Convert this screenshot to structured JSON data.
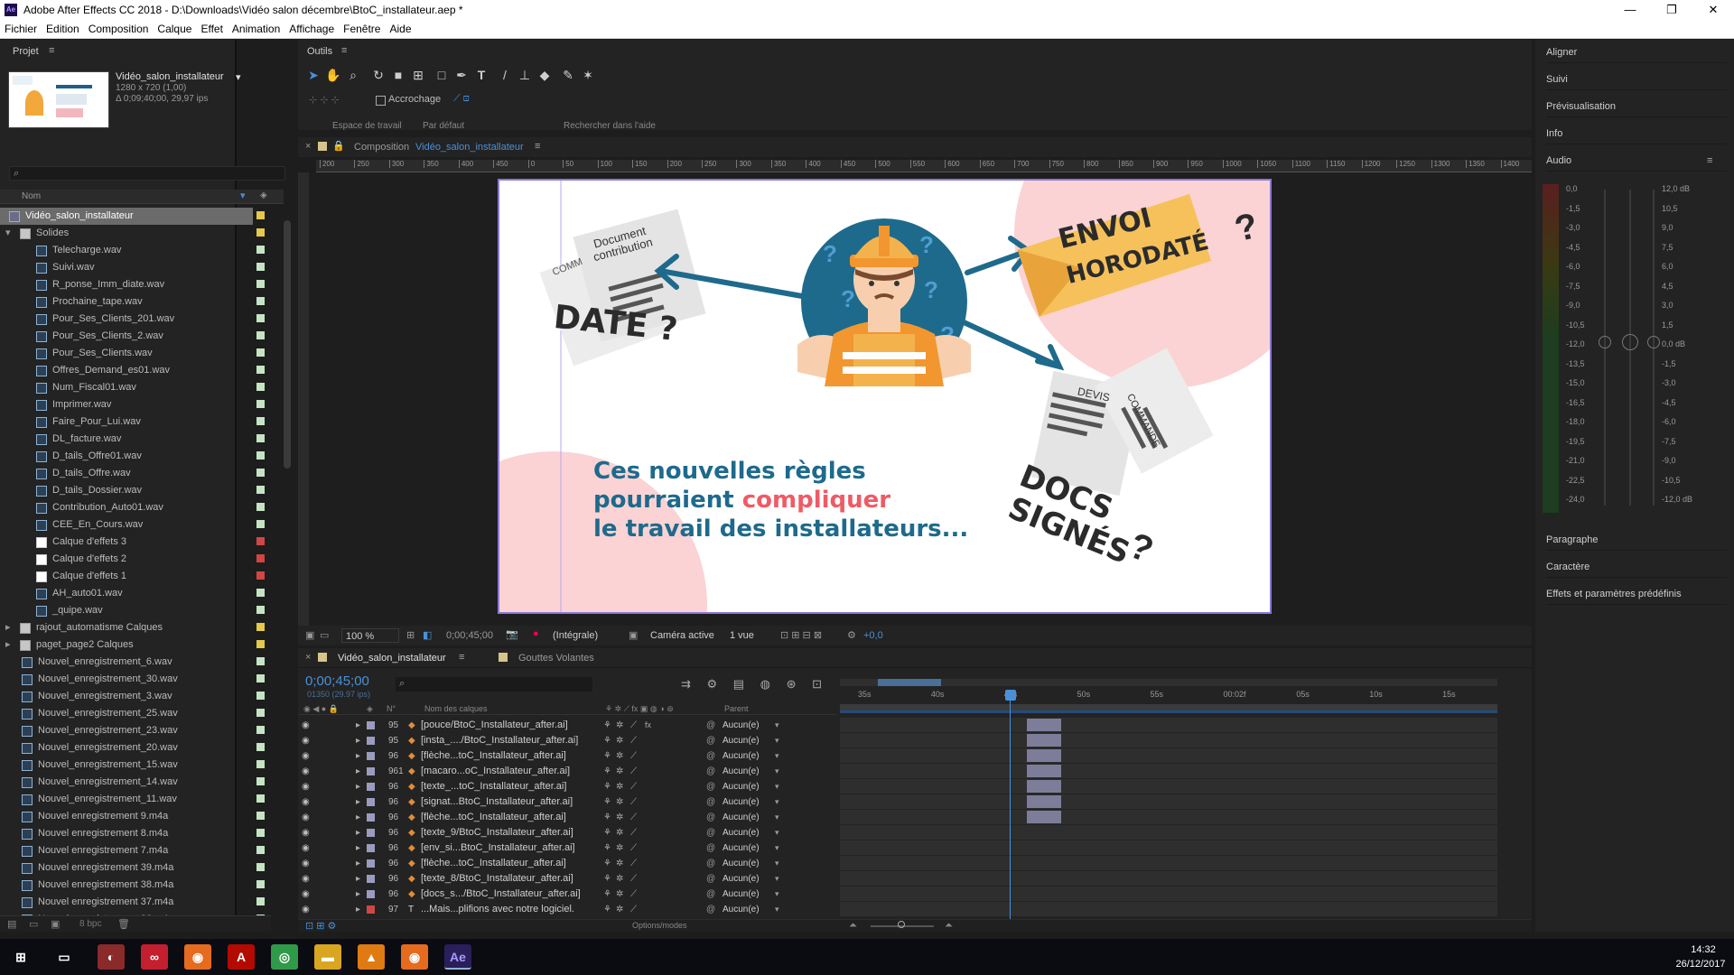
{
  "window": {
    "title": "Adobe After Effects CC 2018 - D:\\Downloads\\Vidéo salon décembre\\BtoC_installateur.aep *",
    "app_badge": "Ae"
  },
  "menu": [
    "Fichier",
    "Edition",
    "Composition",
    "Calque",
    "Effet",
    "Animation",
    "Affichage",
    "Fenêtre",
    "Aide"
  ],
  "project": {
    "tab": "Projet",
    "comp_name": "Vidéo_salon_installateur",
    "comp_res": "1280 x 720 (1,00)",
    "comp_dur": "Δ 0;09;40;00, 29,97 ips",
    "col_name": "Nom",
    "col_type": "Typ",
    "bpc": "8 bpc",
    "items": [
      {
        "name": "Vidéo_salon_installateur",
        "kind": "comp",
        "indent": 0,
        "label": "#e4c94a",
        "selected": true
      },
      {
        "name": "Solides",
        "kind": "folder",
        "indent": 0,
        "label": "#e4c94a",
        "open": true
      },
      {
        "name": "Telecharge.wav",
        "kind": "audio",
        "indent": 1,
        "label": "#c5e4c3"
      },
      {
        "name": "Suivi.wav",
        "kind": "audio",
        "indent": 1,
        "label": "#c5e4c3"
      },
      {
        "name": "R_ponse_Imm_diate.wav",
        "kind": "audio",
        "indent": 1,
        "label": "#c5e4c3"
      },
      {
        "name": "Prochaine_tape.wav",
        "kind": "audio",
        "indent": 1,
        "label": "#c5e4c3"
      },
      {
        "name": "Pour_Ses_Clients_201.wav",
        "kind": "audio",
        "indent": 1,
        "label": "#c5e4c3"
      },
      {
        "name": "Pour_Ses_Clients_2.wav",
        "kind": "audio",
        "indent": 1,
        "label": "#c5e4c3"
      },
      {
        "name": "Pour_Ses_Clients.wav",
        "kind": "audio",
        "indent": 1,
        "label": "#c5e4c3"
      },
      {
        "name": "Offres_Demand_es01.wav",
        "kind": "audio",
        "indent": 1,
        "label": "#c5e4c3"
      },
      {
        "name": "Num_Fiscal01.wav",
        "kind": "audio",
        "indent": 1,
        "label": "#c5e4c3"
      },
      {
        "name": "Imprimer.wav",
        "kind": "audio",
        "indent": 1,
        "label": "#c5e4c3"
      },
      {
        "name": "Faire_Pour_Lui.wav",
        "kind": "audio",
        "indent": 1,
        "label": "#c5e4c3"
      },
      {
        "name": "DL_facture.wav",
        "kind": "audio",
        "indent": 1,
        "label": "#c5e4c3"
      },
      {
        "name": "D_tails_Offre01.wav",
        "kind": "audio",
        "indent": 1,
        "label": "#c5e4c3"
      },
      {
        "name": "D_tails_Offre.wav",
        "kind": "audio",
        "indent": 1,
        "label": "#c5e4c3"
      },
      {
        "name": "D_tails_Dossier.wav",
        "kind": "audio",
        "indent": 1,
        "label": "#c5e4c3"
      },
      {
        "name": "Contribution_Auto01.wav",
        "kind": "audio",
        "indent": 1,
        "label": "#c5e4c3"
      },
      {
        "name": "CEE_En_Cours.wav",
        "kind": "audio",
        "indent": 1,
        "label": "#c5e4c3"
      },
      {
        "name": "Calque d'effets 3",
        "kind": "solid",
        "indent": 1,
        "label": "#d24545"
      },
      {
        "name": "Calque d'effets 2",
        "kind": "solid",
        "indent": 1,
        "label": "#d24545"
      },
      {
        "name": "Calque d'effets 1",
        "kind": "solid",
        "indent": 1,
        "label": "#d24545"
      },
      {
        "name": "AH_auto01.wav",
        "kind": "audio",
        "indent": 1,
        "label": "#c5e4c3"
      },
      {
        "name": "_quipe.wav",
        "kind": "audio",
        "indent": 1,
        "label": "#c5e4c3"
      },
      {
        "name": "rajout_automatisme Calques",
        "kind": "folder",
        "indent": 0,
        "label": "#e4c94a",
        "open": false
      },
      {
        "name": "paget_page2 Calques",
        "kind": "folder",
        "indent": 0,
        "label": "#e4c94a",
        "open": false
      },
      {
        "name": "Nouvel_enregistrement_6.wav",
        "kind": "audio",
        "indent": 0,
        "label": "#c5e4c3"
      },
      {
        "name": "Nouvel_enregistrement_30.wav",
        "kind": "audio",
        "indent": 0,
        "label": "#c5e4c3"
      },
      {
        "name": "Nouvel_enregistrement_3.wav",
        "kind": "audio",
        "indent": 0,
        "label": "#c5e4c3"
      },
      {
        "name": "Nouvel_enregistrement_25.wav",
        "kind": "audio",
        "indent": 0,
        "label": "#c5e4c3"
      },
      {
        "name": "Nouvel_enregistrement_23.wav",
        "kind": "audio",
        "indent": 0,
        "label": "#c5e4c3"
      },
      {
        "name": "Nouvel_enregistrement_20.wav",
        "kind": "audio",
        "indent": 0,
        "label": "#c5e4c3"
      },
      {
        "name": "Nouvel_enregistrement_15.wav",
        "kind": "audio",
        "indent": 0,
        "label": "#c5e4c3"
      },
      {
        "name": "Nouvel_enregistrement_14.wav",
        "kind": "audio",
        "indent": 0,
        "label": "#c5e4c3"
      },
      {
        "name": "Nouvel_enregistrement_11.wav",
        "kind": "audio",
        "indent": 0,
        "label": "#c5e4c3"
      },
      {
        "name": "Nouvel enregistrement 9.m4a",
        "kind": "audio",
        "indent": 0,
        "label": "#c5e4c3"
      },
      {
        "name": "Nouvel enregistrement 8.m4a",
        "kind": "audio",
        "indent": 0,
        "label": "#c5e4c3"
      },
      {
        "name": "Nouvel enregistrement 7.m4a",
        "kind": "audio",
        "indent": 0,
        "label": "#c5e4c3"
      },
      {
        "name": "Nouvel enregistrement 39.m4a",
        "kind": "audio",
        "indent": 0,
        "label": "#c5e4c3"
      },
      {
        "name": "Nouvel enregistrement 38.m4a",
        "kind": "audio",
        "indent": 0,
        "label": "#c5e4c3"
      },
      {
        "name": "Nouvel enregistrement 37.m4a",
        "kind": "audio",
        "indent": 0,
        "label": "#c5e4c3"
      },
      {
        "name": "Nouvel enregistrement 36.m4a",
        "kind": "audio",
        "indent": 0,
        "label": "#c5e4c3"
      }
    ]
  },
  "tools": {
    "tab": "Outils",
    "snap": "Accrochage",
    "workspace_label": "Espace de travail",
    "workspace_value": "Par défaut",
    "help_search": "Rechercher dans l'aide"
  },
  "comp": {
    "tab_prefix": "Composition",
    "tab_name": "Vidéo_salon_installateur",
    "ruler_ticks": [
      "200",
      "250",
      "300",
      "350",
      "400",
      "450",
      "0",
      "50",
      "100",
      "150",
      "200",
      "250",
      "300",
      "350",
      "400",
      "450",
      "500",
      "550",
      "600",
      "650",
      "700",
      "750",
      "800",
      "850",
      "900",
      "950",
      "1000",
      "1050",
      "1100",
      "1150",
      "1200",
      "1250",
      "1300",
      "1350",
      "1400"
    ],
    "zoom": "100 %",
    "time": "0;00;45;00",
    "resolution": "(Intégrale)",
    "camera": "Caméra active",
    "views": "1 vue",
    "exposure": "+0,0",
    "art": {
      "doc1_title": "Document contribution",
      "doc1_back": "COMM",
      "date": "DATE ?",
      "envoi": "ENVOI",
      "horodate": "HORODATÉ",
      "devis": "DEVIS",
      "commande": "COMMANDE",
      "docs": "DOCS",
      "signes": "SIGNÉS",
      "q": "?",
      "line1": "Ces nouvelles règles",
      "line2a": "pourraient",
      "line2b": "compliquer",
      "line3": "le travail des installateurs..."
    }
  },
  "timeline": {
    "tab": "Vidéo_salon_installateur",
    "tab2": "Gouttes Volantes",
    "timecode": "0;00;45;00",
    "frames": "01350 (29.97 ips)",
    "col_n": "N°",
    "col_name": "Nom des calques",
    "col_parent": "Parent",
    "time_ticks": [
      "35s",
      "40s",
      "45s",
      "50s",
      "55s",
      "00:02f",
      "05s",
      "10s",
      "15s"
    ],
    "options": "Options/modes",
    "layers": [
      {
        "n": "95",
        "name": "[pouce/BtoC_Installateur_after.ai]",
        "parent": "Aucun(e)",
        "bar": true,
        "fx": true
      },
      {
        "n": "95",
        "name": "[insta_..../BtoC_Installateur_after.ai]",
        "parent": "Aucun(e)",
        "bar": true
      },
      {
        "n": "96",
        "name": "[flèche...toC_Installateur_after.ai]",
        "parent": "Aucun(e)",
        "bar": true
      },
      {
        "n": "961",
        "name": "[macaro...oC_Installateur_after.ai]",
        "parent": "Aucun(e)",
        "bar": true
      },
      {
        "n": "96",
        "name": "[texte_...toC_Installateur_after.ai]",
        "parent": "Aucun(e)",
        "bar": true
      },
      {
        "n": "96",
        "name": "[signat...BtoC_Installateur_after.ai]",
        "parent": "Aucun(e)",
        "bar": true
      },
      {
        "n": "96",
        "name": "[flèche...toC_Installateur_after.ai]",
        "parent": "Aucun(e)",
        "bar": true
      },
      {
        "n": "96",
        "name": "[texte_9/BtoC_Installateur_after.ai]",
        "parent": "Aucun(e)",
        "bar": false
      },
      {
        "n": "96",
        "name": "[env_si...BtoC_Installateur_after.ai]",
        "parent": "Aucun(e)",
        "bar": false
      },
      {
        "n": "96",
        "name": "[flèche...toC_Installateur_after.ai]",
        "parent": "Aucun(e)",
        "bar": false
      },
      {
        "n": "96",
        "name": "[texte_8/BtoC_Installateur_after.ai]",
        "parent": "Aucun(e)",
        "bar": false
      },
      {
        "n": "96",
        "name": "[docs_s.../BtoC_Installateur_after.ai]",
        "parent": "Aucun(e)",
        "bar": false
      },
      {
        "n": "97",
        "name": "...Mais...plifions avec notre logiciel.",
        "parent": "Aucun(e)",
        "bar": false,
        "text": true
      }
    ]
  },
  "right": {
    "sections_top": [
      "Aligner",
      "Suivi",
      "Prévisualisation",
      "Info"
    ],
    "audio": "Audio",
    "db_left": [
      "0,0",
      "-1,5",
      "-3,0",
      "-4,5",
      "-6,0",
      "-7,5",
      "-9,0",
      "-10,5",
      "-12,0",
      "-13,5",
      "-15,0",
      "-16,5",
      "-18,0",
      "-19,5",
      "-21,0",
      "-22,5",
      "-24,0"
    ],
    "db_right": [
      "12,0 dB",
      "10,5",
      "9,0",
      "7,5",
      "6,0",
      "4,5",
      "3,0",
      "1,5",
      "0,0 dB",
      "-1,5",
      "-3,0",
      "-4,5",
      "-6,0",
      "-7,5",
      "-9,0",
      "-10,5",
      "-12,0 dB"
    ],
    "sections_bottom": [
      "Paragraphe",
      "Caractère",
      "Effets et paramètres prédéfinis"
    ]
  },
  "taskbar": {
    "time": "14:32",
    "date": "26/12/2017"
  }
}
